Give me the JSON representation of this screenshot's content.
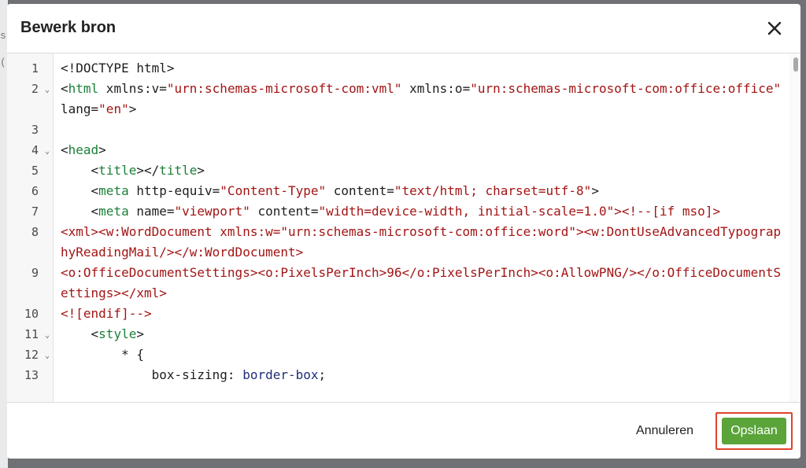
{
  "modal": {
    "title": "Bewerk bron",
    "close_icon": "close-icon"
  },
  "backdrop": {
    "fragments": [
      "s",
      "("
    ]
  },
  "editor": {
    "lines": [
      {
        "num": "1",
        "fold": false,
        "segments": [
          {
            "t": "<!DOCTYPE html>",
            "c": "plain"
          }
        ]
      },
      {
        "num": "2",
        "fold": true,
        "segments": [
          {
            "t": "<",
            "c": "plain"
          },
          {
            "t": "html",
            "c": "tag"
          },
          {
            "t": " xmlns:v=",
            "c": "plain"
          },
          {
            "t": "\"urn:schemas-microsoft-com:vml\"",
            "c": "str"
          },
          {
            "t": " xmlns:o=",
            "c": "plain"
          },
          {
            "t": "\"urn:schemas-microsoft-com:office:office\"",
            "c": "str"
          },
          {
            "t": " lang=",
            "c": "plain"
          },
          {
            "t": "\"en\"",
            "c": "str"
          },
          {
            "t": ">",
            "c": "plain"
          }
        ]
      },
      {
        "num": "3",
        "fold": false,
        "segments": [
          {
            "t": "",
            "c": "plain"
          }
        ]
      },
      {
        "num": "4",
        "fold": true,
        "segments": [
          {
            "t": "<",
            "c": "plain"
          },
          {
            "t": "head",
            "c": "tag"
          },
          {
            "t": ">",
            "c": "plain"
          }
        ]
      },
      {
        "num": "5",
        "fold": false,
        "segments": [
          {
            "t": "    <",
            "c": "plain"
          },
          {
            "t": "title",
            "c": "tag"
          },
          {
            "t": "></",
            "c": "plain"
          },
          {
            "t": "title",
            "c": "tag"
          },
          {
            "t": ">",
            "c": "plain"
          }
        ]
      },
      {
        "num": "6",
        "fold": false,
        "segments": [
          {
            "t": "    <",
            "c": "plain"
          },
          {
            "t": "meta",
            "c": "tag"
          },
          {
            "t": " http-equiv=",
            "c": "plain"
          },
          {
            "t": "\"Content-Type\"",
            "c": "str"
          },
          {
            "t": " content=",
            "c": "plain"
          },
          {
            "t": "\"text/html; charset=utf-8\"",
            "c": "str"
          },
          {
            "t": ">",
            "c": "plain"
          }
        ]
      },
      {
        "num": "7",
        "fold": false,
        "segments": [
          {
            "t": "    <",
            "c": "plain"
          },
          {
            "t": "meta",
            "c": "tag"
          },
          {
            "t": " name=",
            "c": "plain"
          },
          {
            "t": "\"viewport\"",
            "c": "str"
          },
          {
            "t": " content=",
            "c": "plain"
          },
          {
            "t": "\"width=device-width, initial-scale=1.0\"",
            "c": "str"
          },
          {
            "t": "><!--[if mso]>",
            "c": "str"
          }
        ]
      },
      {
        "num": "8",
        "fold": false,
        "segments": [
          {
            "t": "<xml><w:WordDocument xmlns:w=\"urn:schemas-microsoft-com:office:word\"><w:DontUseAdvancedTypographyReadingMail/></w:WordDocument>",
            "c": "str"
          }
        ]
      },
      {
        "num": "9",
        "fold": false,
        "segments": [
          {
            "t": "<o:OfficeDocumentSettings><o:PixelsPerInch>96</o:PixelsPerInch><o:AllowPNG/></o:OfficeDocumentSettings></xml>",
            "c": "str"
          }
        ]
      },
      {
        "num": "10",
        "fold": false,
        "segments": [
          {
            "t": "<![endif]-->",
            "c": "str"
          }
        ]
      },
      {
        "num": "11",
        "fold": true,
        "segments": [
          {
            "t": "    <",
            "c": "plain"
          },
          {
            "t": "style",
            "c": "tag"
          },
          {
            "t": ">",
            "c": "plain"
          }
        ]
      },
      {
        "num": "12",
        "fold": true,
        "segments": [
          {
            "t": "        * {",
            "c": "plain"
          }
        ]
      },
      {
        "num": "13",
        "fold": false,
        "segments": [
          {
            "t": "            box-sizing: ",
            "c": "plain"
          },
          {
            "t": "border-box",
            "c": "val"
          },
          {
            "t": ";",
            "c": "plain"
          }
        ]
      }
    ]
  },
  "footer": {
    "cancel_label": "Annuleren",
    "save_label": "Opslaan"
  },
  "colors": {
    "tag": "#1a7f37",
    "string": "#a31515",
    "value": "#1f2d7a",
    "save_button": "#5aa43a",
    "highlight_outline": "#e0442a"
  }
}
